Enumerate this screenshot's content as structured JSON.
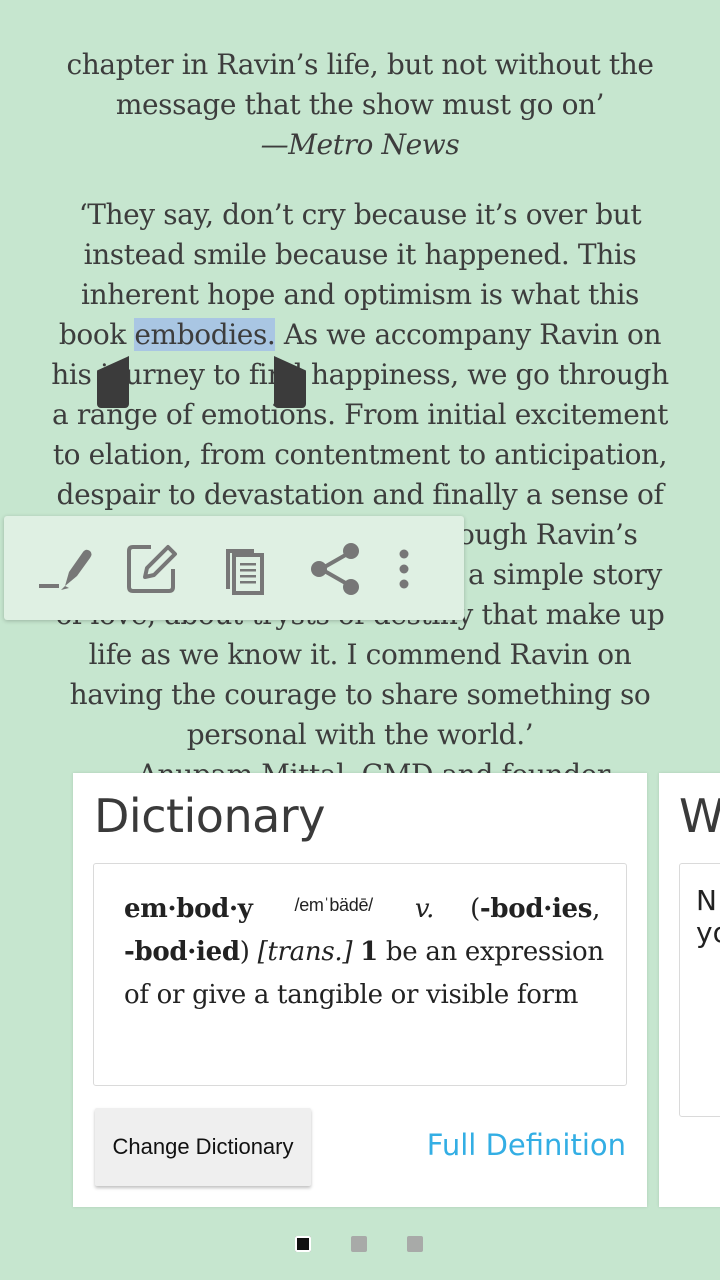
{
  "reader": {
    "lines": [
      "chapter in Ravin’s life, but not without the",
      "message that the show must go on’",
      "—Metro News",
      "‘They say, don’t cry because it’s over but",
      "instead smile because it happened. This",
      "inherent hope and optimism is what this",
      "book ",
      "embodies.",
      " As we accompany Ravin on",
      "his journey to find happiness, we go through",
      "a range of emotions. From initial excitement",
      "to elation, from contentment to anticipation,",
      "despair to devastation and finally a sense of",
      "rough Ravin’s",
      "a simple story",
      "of love, about trysts of destiny that make up",
      "life as we know it. I commend Ravin on",
      "having the courage to share something so",
      "personal with the world.’",
      "—Anupam Mittal, CMD and founder"
    ]
  },
  "toolbar": {
    "buttons": [
      {
        "icon": "highlighter-icon"
      },
      {
        "icon": "note-edit-icon"
      },
      {
        "icon": "copy-icon"
      },
      {
        "icon": "share-icon"
      },
      {
        "icon": "more-vert-icon"
      }
    ]
  },
  "dictionary": {
    "title": "Dictionary",
    "headword": "em·bod·y",
    "pronunciation": "/emˈbädē/",
    "pos": "v.",
    "forms_open": "(",
    "form1": "-bod·ies",
    "forms_comma": ",",
    "form2": "-bod·ied",
    "forms_close": ")",
    "trans": "[trans.]",
    "sense_num": "1",
    "def_part1": "be an expression",
    "def_part2": "of or give a tangible or visible form",
    "change_button": "Change Dictionary",
    "full_definition": "Full Definition"
  },
  "next_card": {
    "title_partial": "W",
    "text_line1": "N",
    "text_line2": "yo"
  },
  "pager": {
    "count": 3,
    "active_index": 0
  },
  "colors": {
    "background": "#c6e6cf",
    "selection": "#a9c6e3",
    "link": "#33aee4"
  }
}
